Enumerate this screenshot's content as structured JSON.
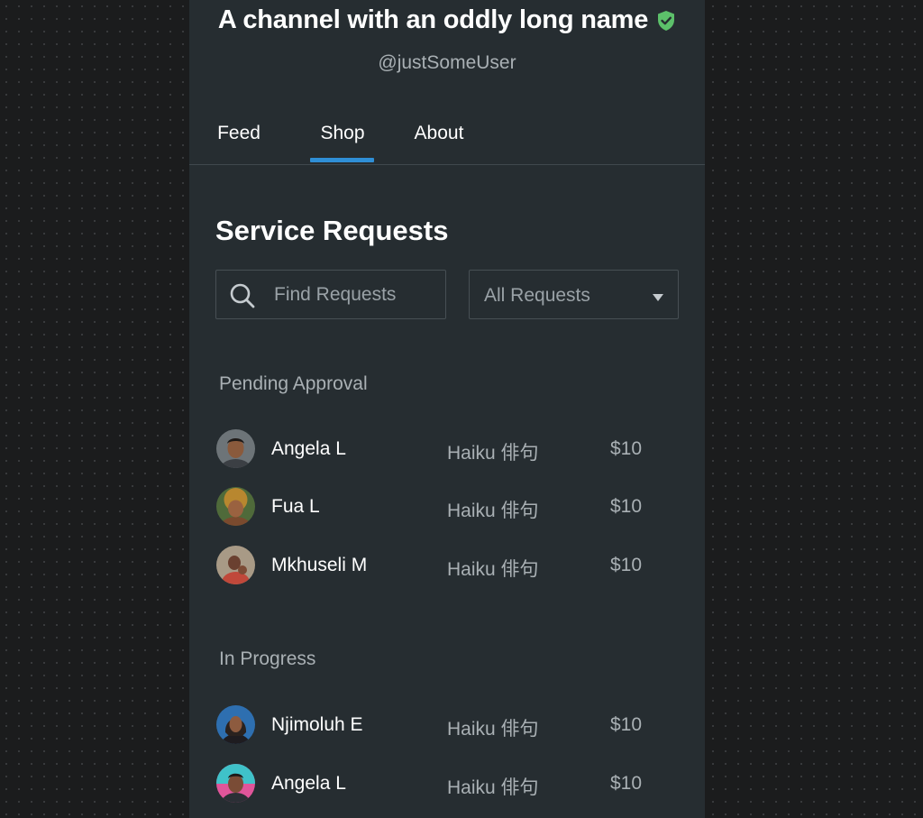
{
  "channel": {
    "title": "A channel with an oddly long name",
    "handle": "@justSomeUser",
    "verified_color": "#5cc06a"
  },
  "tabs": [
    {
      "label": "Feed",
      "active": false
    },
    {
      "label": "Shop",
      "active": true
    },
    {
      "label": "About",
      "active": false
    }
  ],
  "accent_color": "#2f8fd6",
  "service_requests": {
    "title": "Service Requests",
    "search": {
      "placeholder": "Find Requests",
      "value": ""
    },
    "filter": {
      "selected": "All Requests"
    },
    "groups": [
      {
        "label": "Pending Approval",
        "requests": [
          {
            "name": "Angela L",
            "service": "Haiku 俳句",
            "price": "$10"
          },
          {
            "name": "Fua L",
            "service": "Haiku 俳句",
            "price": "$10"
          },
          {
            "name": "Mkhuseli M",
            "service": "Haiku 俳句",
            "price": "$10"
          }
        ]
      },
      {
        "label": "In Progress",
        "requests": [
          {
            "name": "Njimoluh E",
            "service": "Haiku 俳句",
            "price": "$10"
          },
          {
            "name": "Angela L",
            "service": "Haiku 俳句",
            "price": "$10"
          }
        ]
      }
    ]
  }
}
